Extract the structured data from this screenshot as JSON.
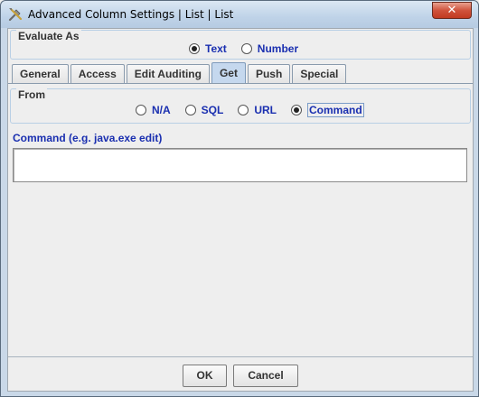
{
  "window": {
    "title": "Advanced Column Settings | List | List",
    "close_glyph": "✕"
  },
  "evaluate_as": {
    "legend": "Evaluate As",
    "options": [
      {
        "label": "Text",
        "selected": true
      },
      {
        "label": "Number",
        "selected": false
      }
    ]
  },
  "tabs": [
    {
      "label": "General",
      "active": false
    },
    {
      "label": "Access",
      "active": false
    },
    {
      "label": "Edit Auditing",
      "active": false
    },
    {
      "label": "Get",
      "active": true
    },
    {
      "label": "Push",
      "active": false
    },
    {
      "label": "Special",
      "active": false
    }
  ],
  "from": {
    "legend": "From",
    "options": [
      {
        "label": "N/A",
        "selected": false
      },
      {
        "label": "SQL",
        "selected": false
      },
      {
        "label": "URL",
        "selected": false
      },
      {
        "label": "Command",
        "selected": true
      }
    ]
  },
  "command": {
    "label": "Command (e.g. java.exe edit)",
    "value": ""
  },
  "buttons": {
    "ok": "OK",
    "cancel": "Cancel"
  },
  "colors": {
    "label_blue": "#1a2fb0",
    "active_tab": "#c5d8ee",
    "close_red": "#c13a21"
  }
}
